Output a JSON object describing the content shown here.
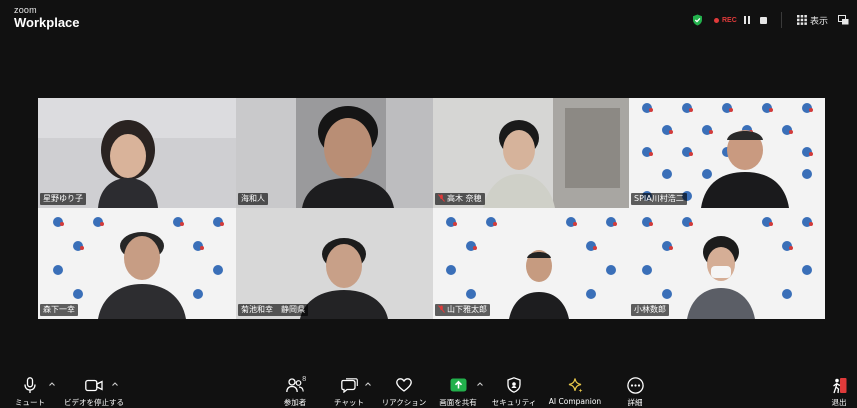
{
  "app": {
    "logo_line1": "zoom",
    "logo_line2": "Workplace"
  },
  "header": {
    "security_icon": "shield-check-icon",
    "recording_label": "REC",
    "view_label": "表示",
    "colors": {
      "recording": "#e03a3a",
      "secure": "#22b14c",
      "active_speaker": "#d7e55a",
      "share": "#22b14c"
    }
  },
  "participants": [
    {
      "name": "星野ゆり子",
      "muted": false,
      "background": "indoor-light"
    },
    {
      "name": "海和人",
      "muted": false,
      "background": "office"
    },
    {
      "name": "高木 奈穂",
      "muted": true,
      "background": "room"
    },
    {
      "name": "SPIA川村浩二",
      "muted": false,
      "background": "backdrop-logo"
    },
    {
      "name": "森下一幸",
      "muted": false,
      "background": "backdrop-logo",
      "active": true
    },
    {
      "name": "菊池和幸　静岡県",
      "muted": false,
      "background": "plain"
    },
    {
      "name": "山下雅太郎",
      "muted": true,
      "background": "backdrop-logo"
    },
    {
      "name": "小林数郎",
      "muted": false,
      "background": "backdrop-logo"
    }
  ],
  "toolbar": {
    "mute_label": "ミュート",
    "video_label": "ビデオを停止する",
    "participants_label": "参加者",
    "participants_count": "8",
    "chat_label": "チャット",
    "reactions_label": "リアクション",
    "share_label": "画面を共有",
    "security_label": "セキュリティ",
    "ai_label": "AI Companion",
    "more_label": "詳細",
    "leave_label": "退出"
  }
}
